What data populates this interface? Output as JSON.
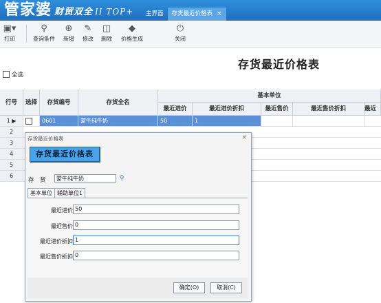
{
  "app": {
    "brand_main": "管家婆",
    "brand_sub": "财贸双全",
    "brand_version": "II TOP+",
    "tabs": [
      {
        "label": "主界面"
      },
      {
        "label": "存货最近价格表",
        "close": "×"
      }
    ]
  },
  "toolbar": {
    "print": "打印",
    "query": "查询条件",
    "add": "新增",
    "edit": "修改",
    "delete": "删除",
    "generate": "价格生成",
    "close": "关闭"
  },
  "page": {
    "title": "存货最近价格表",
    "select_all": "全选"
  },
  "grid": {
    "headers": {
      "row_no": "行号",
      "select": "选择",
      "code": "存货编号",
      "name": "存货全名",
      "group": "基本单位",
      "last_purchase": "最近进价",
      "last_purchase_disc": "最近进价折扣",
      "last_sale": "最近售价",
      "last_sale_disc": "最近售价折扣",
      "last_cut": "最近"
    },
    "rows": [
      {
        "no": "1",
        "code": "0601",
        "name": "蒙牛纯牛奶",
        "price": "50",
        "disc": "1"
      },
      {
        "no": "2",
        "code": "",
        "name": "",
        "price": "",
        "disc": ""
      },
      {
        "no": "3",
        "code": "",
        "name": "",
        "price": "",
        "disc": ""
      },
      {
        "no": "4",
        "code": "",
        "name": "",
        "price": "",
        "disc": ""
      },
      {
        "no": "5",
        "code": "",
        "name": "",
        "price": "",
        "disc": ""
      },
      {
        "no": "6",
        "code": "",
        "name": "",
        "price": "",
        "disc": ""
      }
    ]
  },
  "dialog": {
    "window_title": "存货最近价格表",
    "close": "×",
    "banner": "存货最近价格表",
    "item_label": "存　货",
    "item_value": "蒙牛纯牛奶",
    "tabs": [
      "基本单位",
      "辅助单位1"
    ],
    "fields": {
      "last_purchase_label": "最近进价",
      "last_purchase_value": "50",
      "last_sale_label": "最近售价",
      "last_sale_value": "0",
      "last_purchase_disc_label": "最近进价折扣",
      "last_purchase_disc_value": "1",
      "last_sale_disc_label": "最近售价折扣",
      "last_sale_disc_value": "0"
    },
    "ok": "确定(O)",
    "cancel": "取消(C)"
  }
}
